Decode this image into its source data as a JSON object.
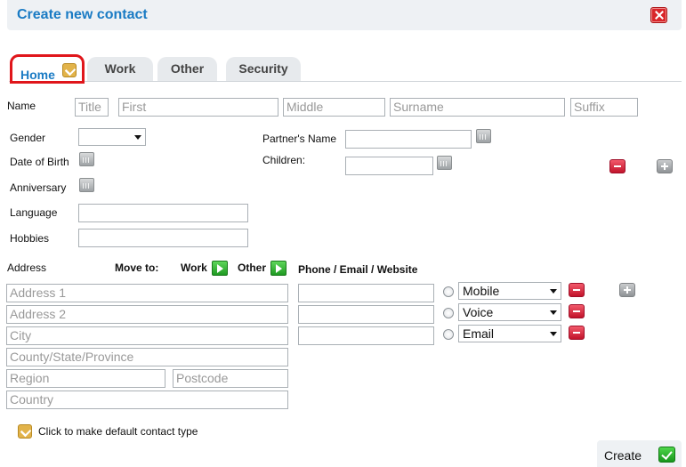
{
  "dialog": {
    "title": "Create new contact"
  },
  "tabs": [
    {
      "label": "Home"
    },
    {
      "label": "Work"
    },
    {
      "label": "Other"
    },
    {
      "label": "Security"
    }
  ],
  "name_row": {
    "label": "Name",
    "title_ph": "Title",
    "first_ph": "First",
    "middle_ph": "Middle",
    "surname_ph": "Surname",
    "suffix_ph": "Suffix"
  },
  "personal": {
    "gender_label": "Gender",
    "gender_value": "",
    "dob_label": "Date of Birth",
    "anniversary_label": "Anniversary",
    "language_label": "Language",
    "hobbies_label": "Hobbies",
    "partner_label": "Partner's Name",
    "children_label": "Children:"
  },
  "address": {
    "label": "Address",
    "move_to_label": "Move to:",
    "work_label": "Work",
    "other_label": "Other",
    "address1_ph": "Address 1",
    "address2_ph": "Address 2",
    "city_ph": "City",
    "county_ph": "County/State/Province",
    "region_ph": "Region",
    "postcode_ph": "Postcode",
    "country_ph": "Country"
  },
  "contact_methods": {
    "heading": "Phone / Email / Website",
    "rows": [
      {
        "type": "Mobile"
      },
      {
        "type": "Voice"
      },
      {
        "type": "Email"
      }
    ]
  },
  "footer": {
    "default_type_text": "Click to make default contact type",
    "create_label": "Create"
  },
  "colors": {
    "accent": "#1a7bc4",
    "highlight_border": "#e0161b",
    "remove": "#d9262a",
    "confirm": "#2aa92d"
  }
}
